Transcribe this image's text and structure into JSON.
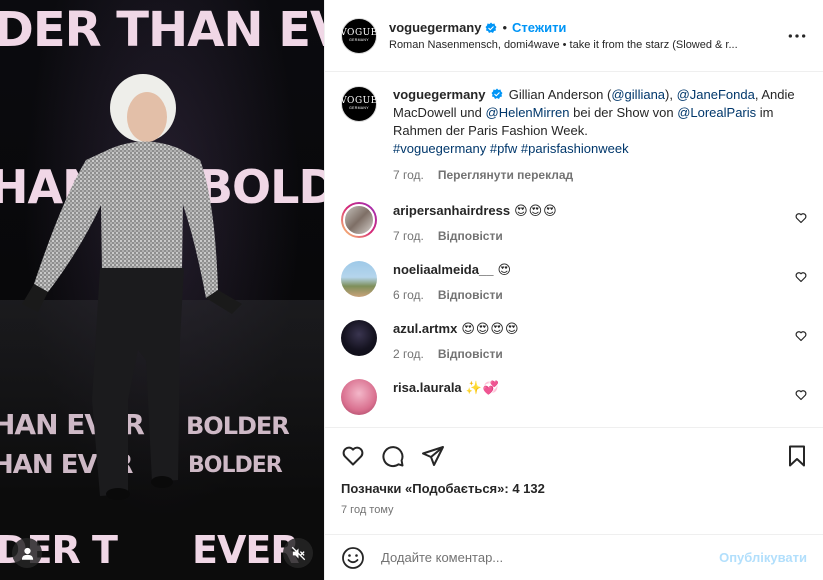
{
  "post": {
    "username": "voguegermany",
    "follow_label": "Стежити",
    "audio": "Roman Nasenmensch, domi4wave • take it from the starz (Slowed & r...",
    "avatar_logo": "VOGUE",
    "avatar_sub": "GERMANY",
    "caption": {
      "p1": "Gillian Anderson (",
      "m1": "@gilliana",
      "p2": "), ",
      "m2": "@JaneFonda",
      "p3": ", Andie MacDowell und ",
      "m3": "@HelenMirren",
      "p4": " bei der Show von ",
      "m4": "@LorealParis",
      "p5": " im Rahmen der Paris Fashion Week.",
      "tags": "#voguegermany #pfw #parisfashionweek",
      "time": "7 год.",
      "translate": "Переглянути переклад"
    }
  },
  "comments": [
    {
      "user": "aripersanhairdress",
      "text": "😍😍😍",
      "time": "7 год.",
      "reply": "Відповісти"
    },
    {
      "user": "noeliaalmeida__",
      "text": "😍",
      "time": "6 год.",
      "reply": "Відповісти"
    },
    {
      "user": "azul.artmx",
      "text": "😍😍😍😍",
      "time": "2 год.",
      "reply": "Відповісти"
    },
    {
      "user": "risa.laurala",
      "text": "✨💞",
      "time": "",
      "reply": ""
    }
  ],
  "likes": {
    "label": "Позначки «Подобається»: ",
    "count": "4 132"
  },
  "posted_ago": "7 год тому",
  "add_comment": {
    "placeholder": "Додайте коментар...",
    "post_label": "Опублікувати"
  },
  "media": {
    "screen_top": "DER THAN EVER",
    "screen_mid_left": "HAN",
    "screen_mid_right": "BOLDER",
    "floor_1_left": "HAN EVER",
    "floor_1_right": "BOLDER",
    "floor_2_left": "HAN EVER",
    "floor_2_right": "BOLDER",
    "floor_3_left": "DER T",
    "floor_3_right": "EVER"
  },
  "colors": {
    "accent": "#0095f6",
    "mention": "#00376b",
    "muted": "#737373",
    "post_disabled": "#b2dffc"
  },
  "icons": [
    "more-icon",
    "verified-icon",
    "heart-icon",
    "comment-icon",
    "share-icon",
    "bookmark-icon",
    "emoji-icon",
    "user-tag-icon",
    "mute-icon"
  ]
}
